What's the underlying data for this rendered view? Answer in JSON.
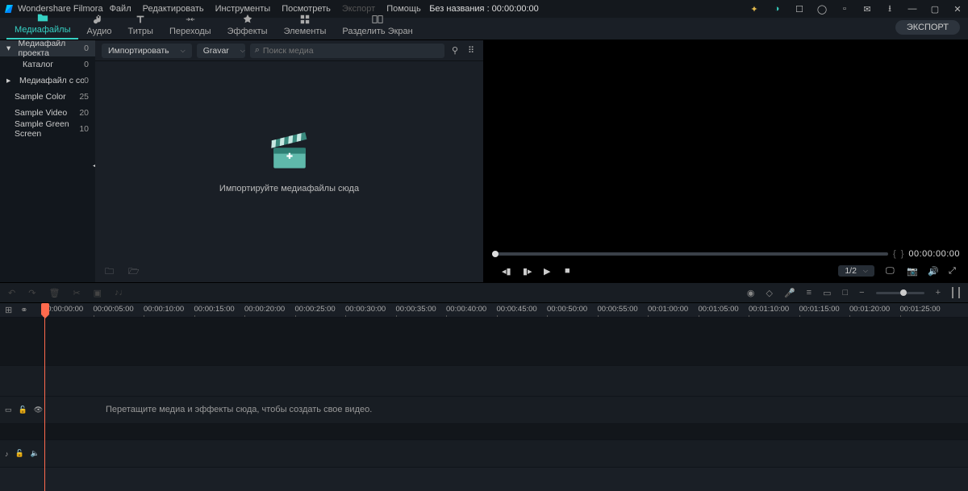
{
  "app_name": "Wondershare Filmora",
  "menu": [
    "Файл",
    "Редактировать",
    "Инструменты",
    "Посмотреть",
    "Экспорт",
    "Помощь"
  ],
  "menu_disabled_index": 4,
  "title_center": "Без названия : 00:00:00:00",
  "tabs": [
    {
      "label": "Медиафайлы"
    },
    {
      "label": "Аудио"
    },
    {
      "label": "Титры"
    },
    {
      "label": "Переходы"
    },
    {
      "label": "Эффекты"
    },
    {
      "label": "Элементы"
    },
    {
      "label": "Разделить Экран"
    }
  ],
  "active_tab": 0,
  "export_label": "ЭКСПОРТ",
  "sidebar": [
    {
      "label": "Медиафайл проекта",
      "count": "0",
      "active": true,
      "arrow": "down"
    },
    {
      "label": "Каталог",
      "count": "0",
      "indent": true
    },
    {
      "label": "Медиафайл с совмест",
      "count": "0",
      "arrow": "right"
    },
    {
      "label": "Sample Color",
      "count": "25"
    },
    {
      "label": "Sample Video",
      "count": "20"
    },
    {
      "label": "Sample Green Screen",
      "count": "10"
    }
  ],
  "import_dd": "Импортировать",
  "sort_dd": "Gravar",
  "search_placeholder": "Поиск медиа",
  "drop_text": "Импортируйте медиафайлы сюда",
  "preview": {
    "timecode": "00:00:00:00",
    "scale": "1/2"
  },
  "ruler": [
    "00:00:00:00",
    "00:00:05:00",
    "00:00:10:00",
    "00:00:15:00",
    "00:00:20:00",
    "00:00:25:00",
    "00:00:30:00",
    "00:00:35:00",
    "00:00:40:00",
    "00:00:45:00",
    "00:00:50:00",
    "00:00:55:00",
    "00:01:00:00",
    "00:01:05:00",
    "00:01:10:00",
    "00:01:15:00",
    "00:01:20:00",
    "00:01:25:00"
  ],
  "timeline_hint": "Перетащите медиа и эффекты сюда, чтобы создать свое видео."
}
